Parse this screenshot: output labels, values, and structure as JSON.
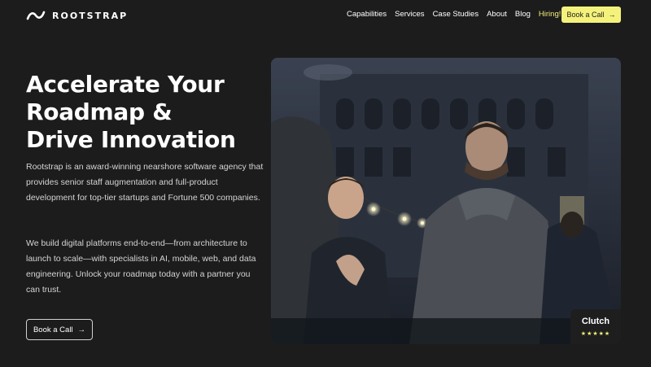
{
  "brand": {
    "name": "ROOTSTRAP"
  },
  "nav": {
    "items": [
      {
        "label": "Capabilities"
      },
      {
        "label": "Services"
      },
      {
        "label": "Case Studies"
      },
      {
        "label": "About"
      },
      {
        "label": "Blog"
      },
      {
        "label": "Hiring!"
      }
    ],
    "cta_label": "Book a Call"
  },
  "hero": {
    "headline_lines": [
      "Accelerate Your",
      "Roadmap &",
      "Drive Innovation"
    ],
    "paragraph_1": "Rootstrap is an award-winning nearshore software agency that provides senior staff augmentation and full-product development for top-tier startups and Fortune 500 companies.",
    "paragraph_2": "We build digital platforms end-to-end—from architecture to launch to scale—with specialists in AI, mobile, web, and data engineering. Unlock your roadmap today with a partner you can trust.",
    "cta_label": "Book a Call"
  },
  "badge": {
    "name": "Clutch",
    "stars": "★★★★★",
    "rating": 5
  },
  "colors": {
    "background": "#1c1c1c",
    "accent": "#f4f27b",
    "text": "#ffffff",
    "muted": "#d4d4d4"
  }
}
